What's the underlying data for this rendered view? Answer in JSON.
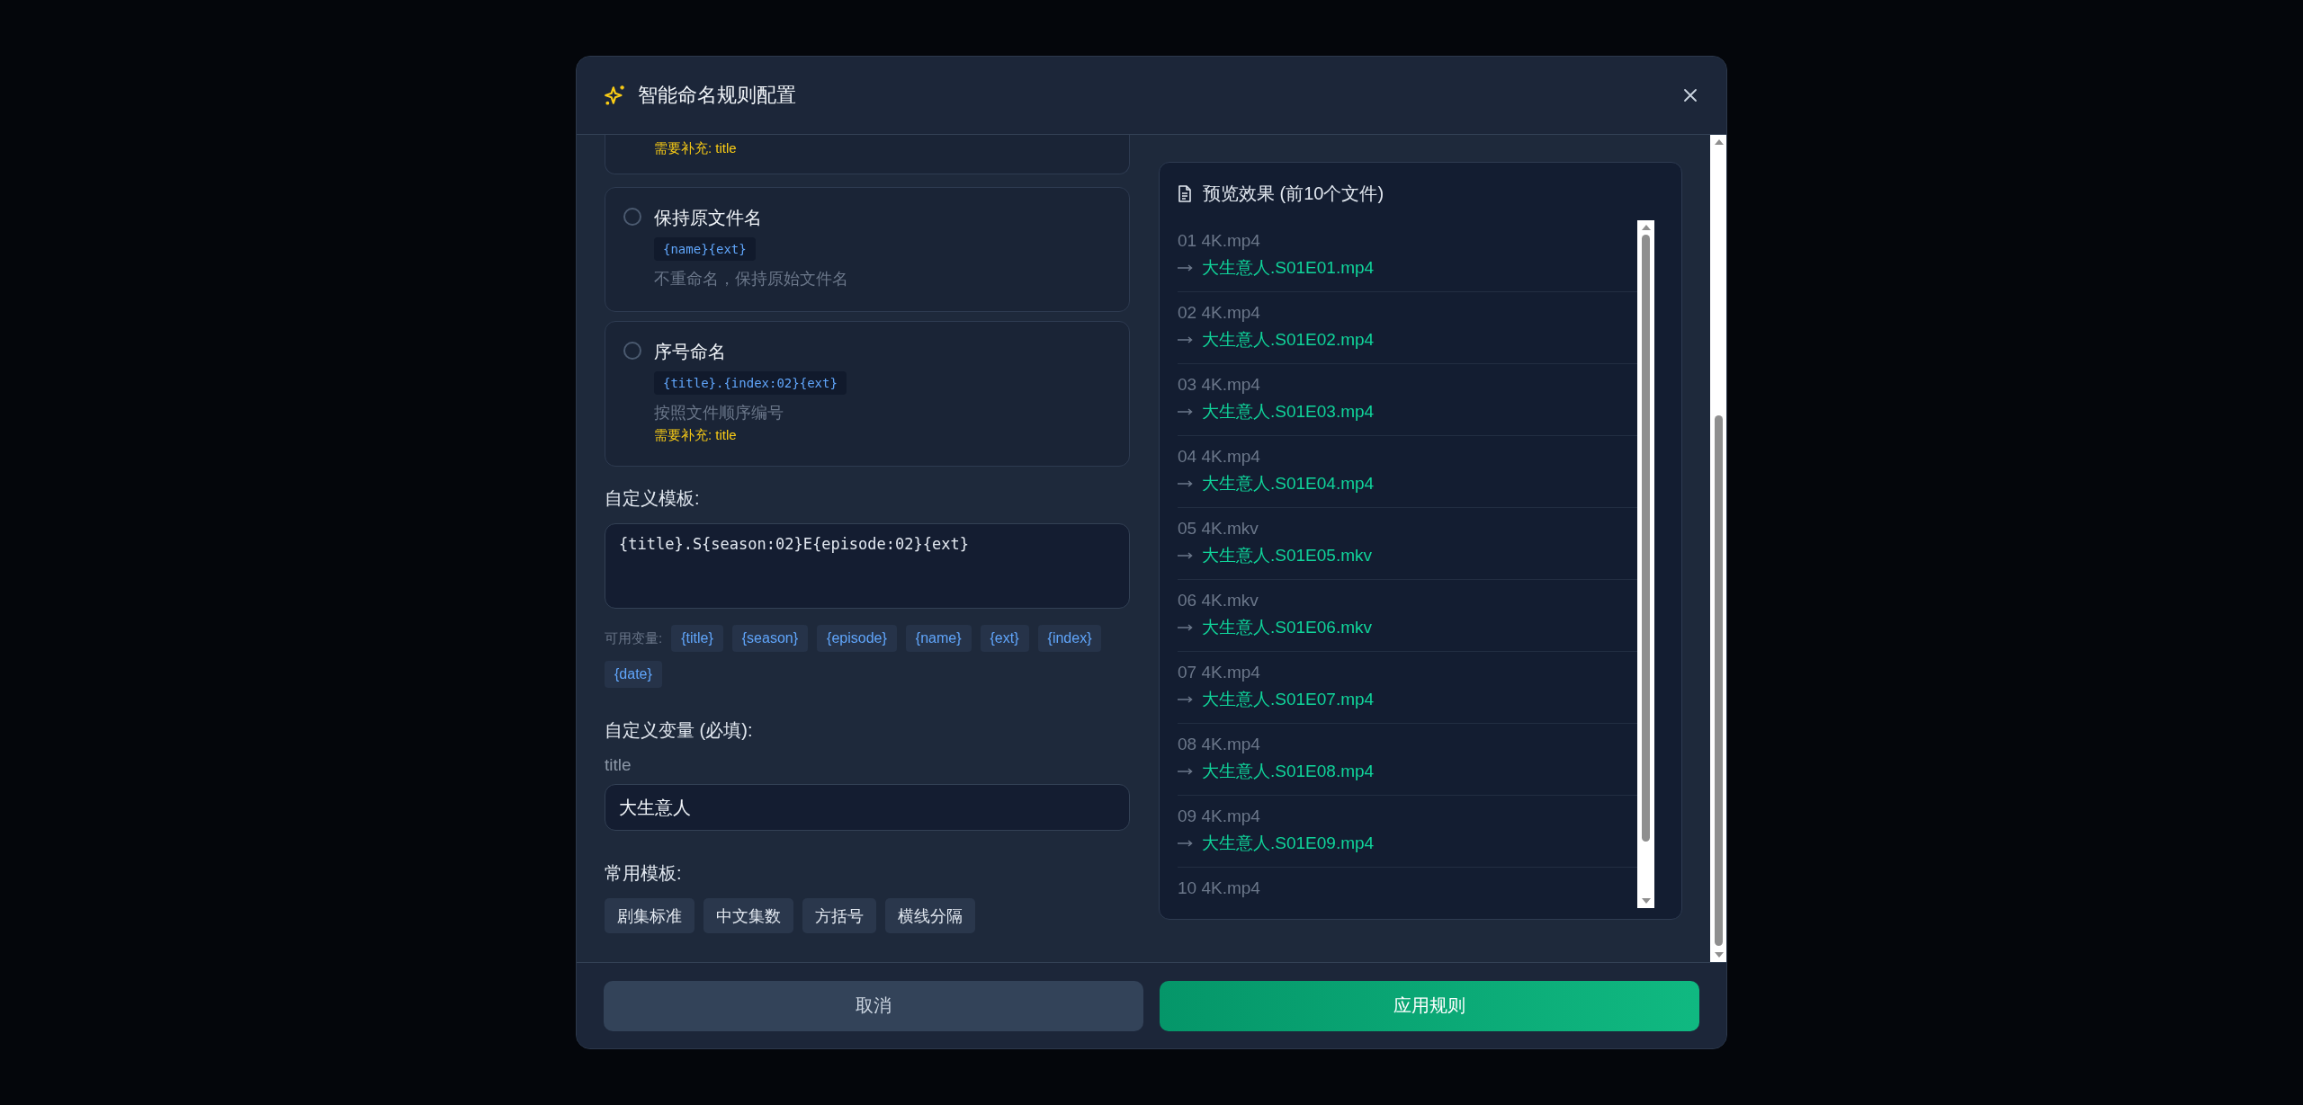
{
  "dialog": {
    "title": "智能命名规则配置"
  },
  "partial_option": {
    "requirement": "需要补充: title"
  },
  "options": [
    {
      "title": "保持原文件名",
      "template": "{name}{ext}",
      "description": "不重命名，保持原始文件名",
      "selected": false
    },
    {
      "title": "序号命名",
      "template": "{title}.{index:02}{ext}",
      "description": "按照文件顺序编号",
      "requirement": "需要补充: title",
      "selected": false
    }
  ],
  "custom_template": {
    "label": "自定义模板:",
    "value": "{title}.S{season:02}E{episode:02}{ext}"
  },
  "variables": {
    "label": "可用变量:",
    "items": [
      "{title}",
      "{season}",
      "{episode}",
      "{name}",
      "{ext}",
      "{index}",
      "{date}"
    ]
  },
  "custom_variables": {
    "label": "自定义变量 (必填):",
    "fields": [
      {
        "name": "title",
        "value": "大生意人"
      }
    ]
  },
  "presets": {
    "label": "常用模板:",
    "items": [
      "剧集标准",
      "中文集数",
      "方括号",
      "横线分隔"
    ]
  },
  "preview": {
    "title": "预览效果 (前10个文件)",
    "rows": [
      {
        "original": "01 4K.mp4",
        "renamed": "大生意人.S01E01.mp4"
      },
      {
        "original": "02 4K.mp4",
        "renamed": "大生意人.S01E02.mp4"
      },
      {
        "original": "03 4K.mp4",
        "renamed": "大生意人.S01E03.mp4"
      },
      {
        "original": "04 4K.mp4",
        "renamed": "大生意人.S01E04.mp4"
      },
      {
        "original": "05 4K.mkv",
        "renamed": "大生意人.S01E05.mkv"
      },
      {
        "original": "06 4K.mkv",
        "renamed": "大生意人.S01E06.mkv"
      },
      {
        "original": "07 4K.mp4",
        "renamed": "大生意人.S01E07.mp4"
      },
      {
        "original": "08 4K.mp4",
        "renamed": "大生意人.S01E08.mp4"
      },
      {
        "original": "09 4K.mp4",
        "renamed": "大生意人.S01E09.mp4"
      },
      {
        "original": "10 4K.mp4"
      }
    ]
  },
  "buttons": [
    {
      "label": "取消",
      "kind": "secondary"
    },
    {
      "label": "应用规则",
      "kind": "primary"
    }
  ]
}
